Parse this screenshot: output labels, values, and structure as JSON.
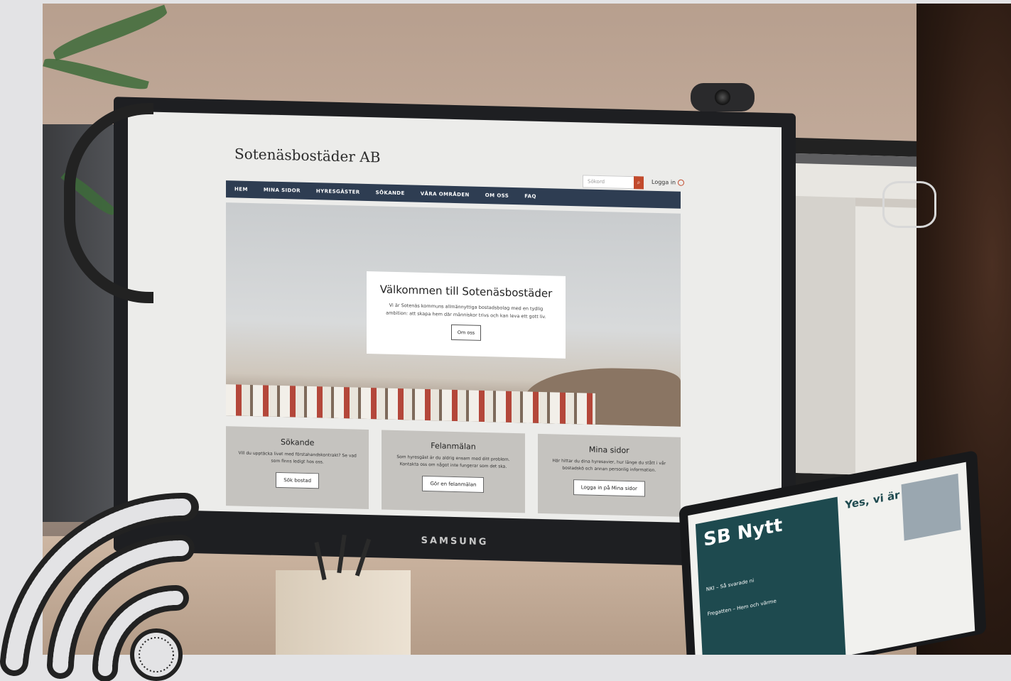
{
  "site": {
    "title": "Sotenäsbostäder AB",
    "search_placeholder": "Sökord",
    "login": "Logga in",
    "nav": [
      "HEM",
      "MINA SIDOR",
      "HYRESGÄSTER",
      "SÖKANDE",
      "VÅRA OMRÅDEN",
      "OM OSS",
      "FAQ"
    ],
    "hero": {
      "title": "Välkommen till Sotenäsbostäder",
      "text": "Vi är Sotenäs kommuns allmännyttiga bostadsbolag med en tydlig ambition: att skapa hem där människor trivs och kan leva ett gott liv.",
      "button": "Om oss"
    },
    "tiles": [
      {
        "title": "Sökande",
        "text": "Vill du upptäcka livet med förstahandskontrakt? Se vad som finns ledigt hos oss.",
        "button": "Sök bostad"
      },
      {
        "title": "Felanmälan",
        "text": "Som hyresgäst är du aldrig ensam med ditt problem. Kontakta oss om något inte fungerar som det ska.",
        "button": "Gör en felanmälan"
      },
      {
        "title": "Mina sidor",
        "text": "Här hittar du dina hyresavier, hur länge du stått i vår bostadskö och annan personlig information.",
        "button": "Logga in på Mina sidor"
      }
    ]
  },
  "monitor_brand": "SAMSUNG",
  "magazine": {
    "title": "SB Nytt",
    "headline": "Yes, vi är tillbaka!",
    "item1": "NKI – Så svarade ni",
    "item2": "Fregatten – Hem och värme"
  },
  "colors": {
    "nav": "#2e3d52",
    "accent": "#c24a2c"
  }
}
